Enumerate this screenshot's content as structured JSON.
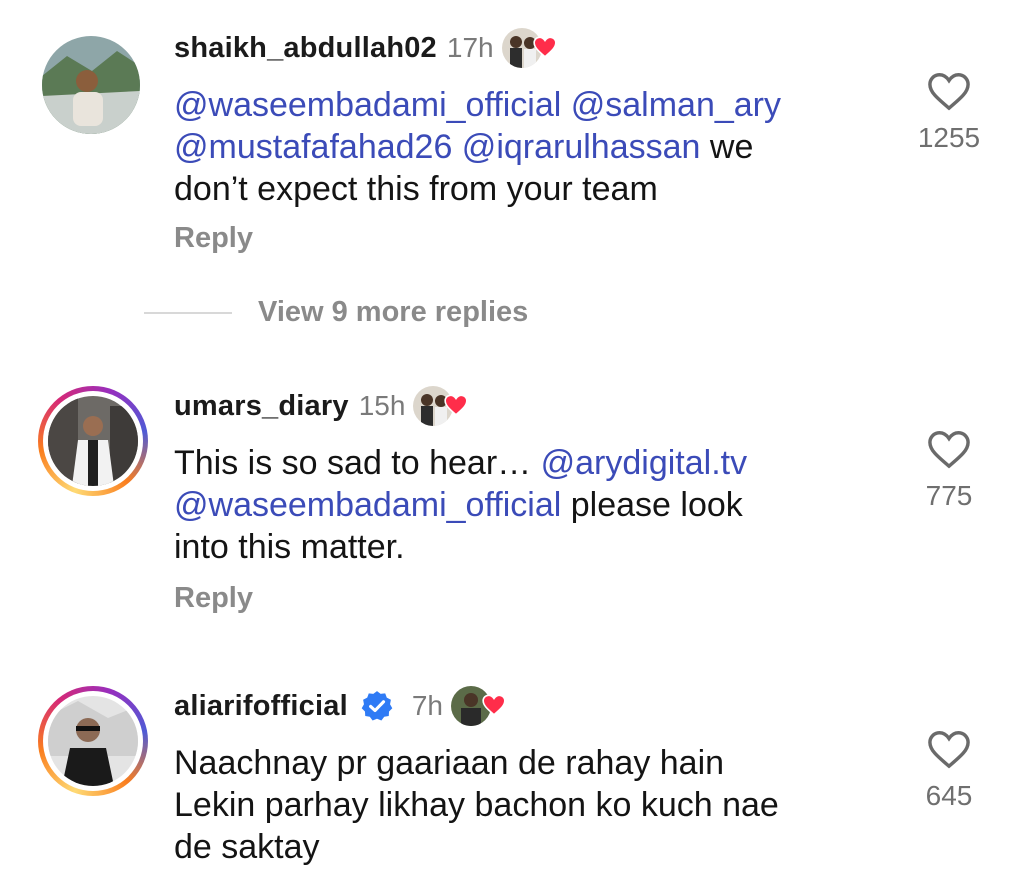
{
  "comments": [
    {
      "username": "shaikh_abdullah02",
      "time": "17h",
      "verified": false,
      "body_mentions_1": "@waseembadami_official @salman_ary",
      "body_mentions_2": "@mustafafahad26 @iqrarulhassan",
      "body_plain_2": " we",
      "body_plain_3": "don’t expect this from your team",
      "likes": "1255",
      "reply_label": "Reply"
    },
    {
      "username": "umars_diary",
      "time": "15h",
      "verified": false,
      "body_plain_1": "This is so sad to hear… ",
      "body_mentions_1": "@arydigital.tv",
      "body_mentions_2": "@waseembadami_official",
      "body_plain_2": " please look",
      "body_plain_3": "into this matter.",
      "likes": "775",
      "reply_label": "Reply"
    },
    {
      "username": "aliarifofficial",
      "time": "7h",
      "verified": true,
      "body_plain_1": "Naachnay pr gaariaan de rahay hain",
      "body_plain_2": "Lekin parhay likhay bachon ko kuch nae",
      "body_plain_3": "de saktay",
      "likes": "645"
    }
  ],
  "view_more_replies": "View 9 more replies",
  "colors": {
    "mention": "#3b4bb8",
    "verified": "#2f7bf5",
    "heart": "#ff2d4a"
  }
}
